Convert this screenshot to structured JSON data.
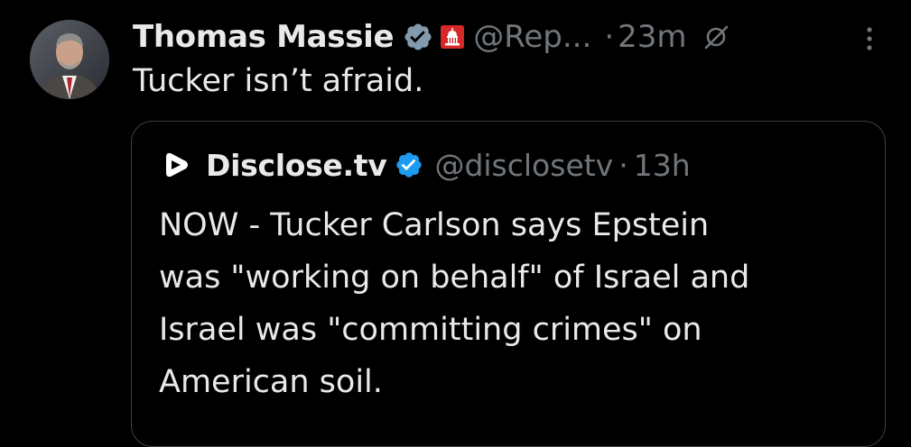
{
  "tweet": {
    "author_name": "Thomas Massie",
    "handle": "@Rep...",
    "separator": "·",
    "time": "23m",
    "text": "Tucker isn’t afraid.",
    "avatar_icon": "profile-photo",
    "verified_icon": "verified-badge-icon",
    "gov_icon": "government-capitol-icon",
    "edit_icon": "edited-icon",
    "more_icon": "more-options-icon"
  },
  "quote": {
    "author_name": "Disclose.tv",
    "handle": "@disclosetv",
    "separator": "·",
    "time": "13h",
    "text_lines": [
      "NOW - Tucker Carlson says Epstein",
      "was \"working on behalf\" of Israel and",
      "Israel was \"committing crimes\" on",
      "American soil."
    ],
    "avatar_icon": "disclose-logo-icon",
    "verified_icon": "verified-badge-icon"
  },
  "colors": {
    "background": "#000000",
    "primary_text": "#e7e9ea",
    "secondary_text": "#71767b",
    "verified_blue": "#1d9bf0",
    "verified_gray": "#829aab",
    "gov_red": "#d62828",
    "border": "#3b3f43"
  }
}
